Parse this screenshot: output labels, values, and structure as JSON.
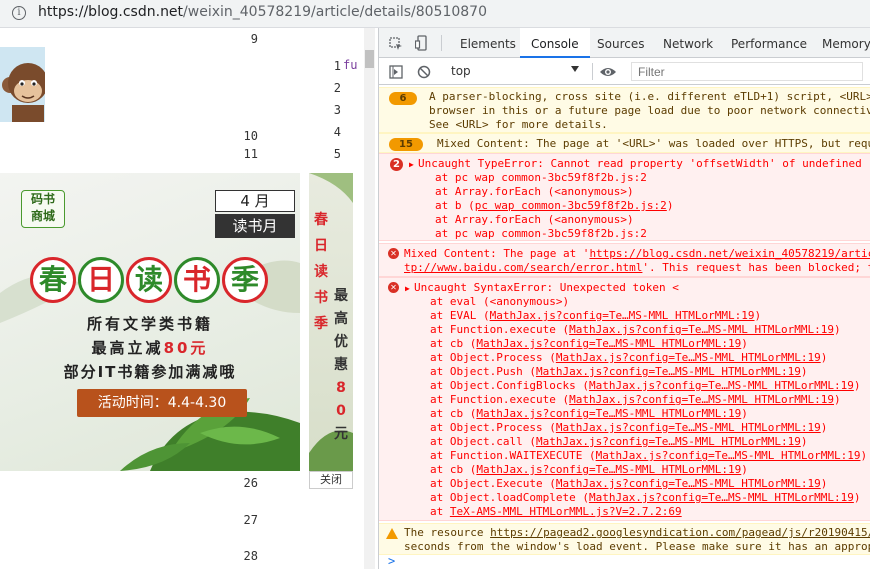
{
  "browser": {
    "url_host": "https://blog.csdn.net",
    "url_path": "/weixin_40578219/article/details/80510870"
  },
  "page": {
    "line_numbers_top": [
      "9",
      "10",
      "11"
    ],
    "line_numbers_bottom": [
      "26",
      "27",
      "28"
    ],
    "code_line_numbers": [
      "1",
      "2",
      "3",
      "4",
      "5"
    ],
    "code_keyword": "fu",
    "banner": {
      "logo_line1": "码书",
      "logo_line2": "商城",
      "month": "4 月",
      "subtitle": "读书月",
      "title_chars": [
        "春",
        "日",
        "读",
        "书",
        "季"
      ],
      "line1": "所有文学类书籍",
      "line2_prefix": "最高立减",
      "line2_highlight": "80元",
      "line3": "部分IT书籍参加满减哦",
      "ribbon": "活动时间：4.4-4.30"
    },
    "side_banner": {
      "col1": [
        "春",
        "日",
        "读",
        "书",
        "季"
      ],
      "col2": [
        "最",
        "高",
        "优",
        "惠",
        "8",
        "0",
        "元"
      ]
    },
    "close_label": "关闭"
  },
  "devtools": {
    "tabs": [
      "Elements",
      "Console",
      "Sources",
      "Network",
      "Performance",
      "Memory"
    ],
    "active_tab": "Console",
    "context": "top",
    "filter_placeholder": "Filter",
    "messages": {
      "warn1": {
        "count": "6",
        "lines": [
          "A parser-blocking, cross site (i.e. different eTLD+1) script, <URL>",
          "browser in this or a future page load due to poor network connectiv",
          "See <URL> for more details."
        ]
      },
      "warn2": {
        "count": "15",
        "text": "Mixed Content: The page at '<URL>' was loaded over HTTPS, but requ"
      },
      "err1": {
        "count": "2",
        "head": "Uncaught TypeError: Cannot read property 'offsetWidth' of undefined",
        "stack": [
          {
            "at": "at pc wap common-3bc59f8f2b.js:2",
            "link": ""
          },
          {
            "at": "at Array.forEach (<anonymous>)",
            "link": ""
          },
          {
            "at": "at b (",
            "link": "pc wap common-3bc59f8f2b.js:2",
            "tail": ")"
          },
          {
            "at": "at Array.forEach (<anonymous>)",
            "link": ""
          },
          {
            "at": "at pc wap common-3bc59f8f2b.js:2",
            "link": ""
          }
        ]
      },
      "err2": {
        "prefix": "Mixed Content: The page at '",
        "link1": "https://blog.csdn.net/weixin_40578219/artic",
        "line2_link": "tp://www.baidu.com/search/error.html",
        "line2_tail": "'. This request has been blocked; t"
      },
      "err3": {
        "head": "Uncaught SyntaxError: Unexpected token <",
        "stack": [
          {
            "at": "at eval (<anonymous>)",
            "link": "",
            "tail": ""
          },
          {
            "at": "at EVAL (",
            "link": "MathJax.js?config=Te…MS-MML HTMLorMML:19",
            "tail": ")"
          },
          {
            "at": "at Function.execute (",
            "link": "MathJax.js?config=Te…MS-MML HTMLorMML:19",
            "tail": ")"
          },
          {
            "at": "at cb (",
            "link": "MathJax.js?config=Te…MS-MML HTMLorMML:19",
            "tail": ")"
          },
          {
            "at": "at Object.Process (",
            "link": "MathJax.js?config=Te…MS-MML HTMLorMML:19",
            "tail": ")"
          },
          {
            "at": "at Object.Push (",
            "link": "MathJax.js?config=Te…MS-MML HTMLorMML:19",
            "tail": ")"
          },
          {
            "at": "at Object.ConfigBlocks (",
            "link": "MathJax.js?config=Te…MS-MML HTMLorMML:19",
            "tail": ")"
          },
          {
            "at": "at Function.execute (",
            "link": "MathJax.js?config=Te…MS-MML HTMLorMML:19",
            "tail": ")"
          },
          {
            "at": "at cb (",
            "link": "MathJax.js?config=Te…MS-MML HTMLorMML:19",
            "tail": ")"
          },
          {
            "at": "at Object.Process (",
            "link": "MathJax.js?config=Te…MS-MML HTMLorMML:19",
            "tail": ")"
          },
          {
            "at": "at Object.call (",
            "link": "MathJax.js?config=Te…MS-MML HTMLorMML:19",
            "tail": ")"
          },
          {
            "at": "at Function.WAITEXECUTE (",
            "link": "MathJax.js?config=Te…MS-MML HTMLorMML:19",
            "tail": ")"
          },
          {
            "at": "at cb (",
            "link": "MathJax.js?config=Te…MS-MML HTMLorMML:19",
            "tail": ")"
          },
          {
            "at": "at Object.Execute (",
            "link": "MathJax.js?config=Te…MS-MML HTMLorMML:19",
            "tail": ")"
          },
          {
            "at": "at Object.loadComplete (",
            "link": "MathJax.js?config=Te…MS-MML HTMLorMML:19",
            "tail": ")"
          },
          {
            "at": "at ",
            "link": "TeX-AMS-MML HTMLorMML.js?V=2.7.2:69",
            "tail": ""
          }
        ]
      },
      "warn3": {
        "prefix": "The resource ",
        "link": "https://pagead2.googlesyndication.com/pagead/js/r20190415/",
        "line2": "seconds from the window's load event. Please make sure it has an approp"
      }
    }
  },
  "colors": {
    "accent": "#1a73e8",
    "error": "#f00",
    "warning_bg": "#fffbe5",
    "error_bg": "#fff0f0",
    "banner_red": "#d9262b",
    "banner_green": "#4a9a2e"
  }
}
